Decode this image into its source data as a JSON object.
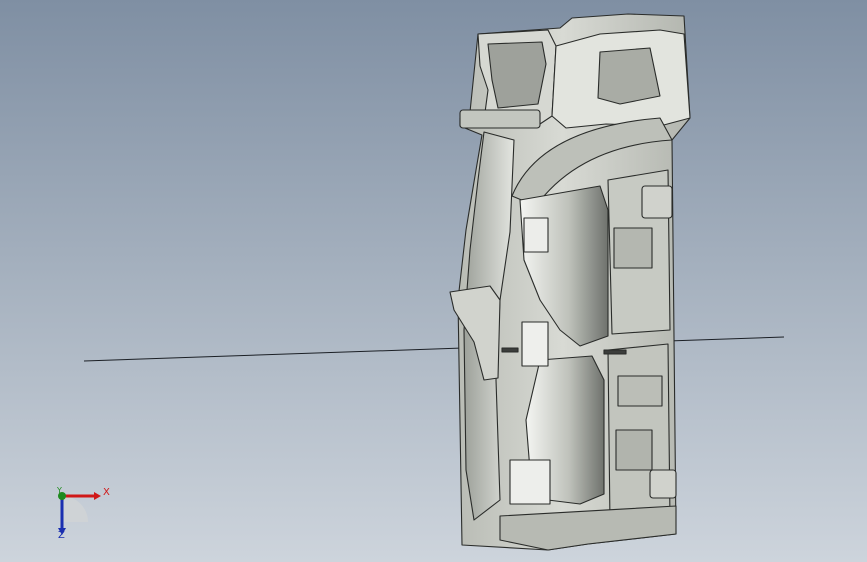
{
  "view": {
    "background_top": "#7f8fa3",
    "background_bottom": "#cdd4dc"
  },
  "triad": {
    "x_label": "X",
    "y_label": "Y",
    "z_label": "Z",
    "x_color": "#d01818",
    "y_color": "#1f8a1f",
    "z_color": "#1a2fb0"
  },
  "model": {
    "icon": "automotive-headlamp-housing-part",
    "body_color": "#c9cbc5",
    "shade_color": "#9ea19b",
    "edge_color": "#2a2c2a"
  }
}
